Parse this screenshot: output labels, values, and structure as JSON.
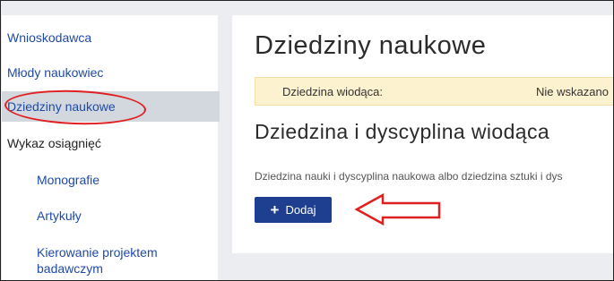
{
  "sidebar": {
    "items": [
      {
        "label": "Wnioskodawca"
      },
      {
        "label": "Młody naukowiec"
      },
      {
        "label": "Dziedziny naukowe"
      },
      {
        "label": "Wykaz osiągnięć"
      },
      {
        "label": "Monografie"
      },
      {
        "label": "Artykuły"
      },
      {
        "label": "Kierowanie projektem",
        "label2": "badawczym"
      }
    ]
  },
  "main": {
    "title": "Dziedziny naukowe",
    "alert": {
      "label": "Dziedzina wiodąca:",
      "value": "Nie wskazano"
    },
    "section_title": "Dziedzina i dyscyplina wiodąca",
    "description": "Dziedzina nauki i dyscyplina naukowa albo dziedzina sztuki i dys",
    "add_button": {
      "icon": "plus-icon",
      "label": "Dodaj"
    }
  },
  "colors": {
    "link": "#1f4aa8",
    "active_bg": "#d3d7de",
    "alert_bg": "#fdf2cf",
    "button_bg": "#1e3f8f",
    "annotation": "#e02020"
  }
}
